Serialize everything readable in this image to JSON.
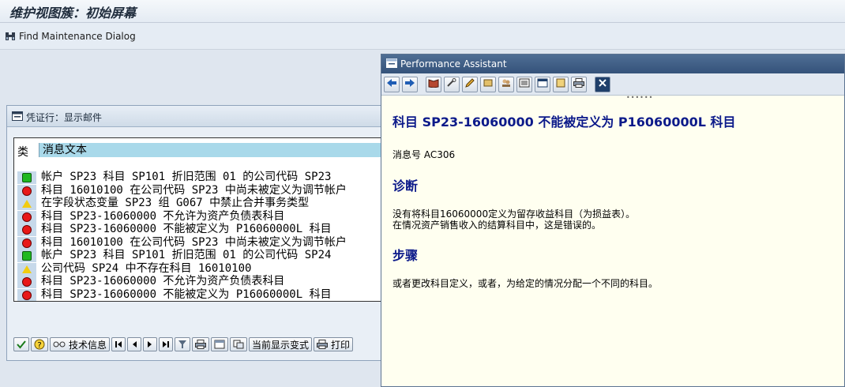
{
  "window": {
    "title": "维护视图簇：初始屏幕"
  },
  "toolbar": {
    "find_label": "Find Maintenance Dialog"
  },
  "log_dialog": {
    "title": "凭证行：显示邮件",
    "columns": {
      "type": "类",
      "text": "消息文本"
    },
    "rows": [
      {
        "status": "green",
        "text": "帐户 SP23 科目 SP101 折旧范围 01 的公司代码 SP23"
      },
      {
        "status": "red",
        "text": "科目 16010100 在公司代码 SP23 中尚未被定义为调节帐户"
      },
      {
        "status": "yellow",
        "text": "在字段状态变量 SP23 组 G067 中禁止合并事务类型"
      },
      {
        "status": "red",
        "text": "科目 SP23-16060000 不允许为资产负债表科目"
      },
      {
        "status": "red",
        "text": "科目 SP23-16060000 不能被定义为 P16060000L 科目"
      },
      {
        "status": "red",
        "text": "科目 16010100 在公司代码 SP23 中尚未被定义为调节帐户"
      },
      {
        "status": "green",
        "text": "帐户 SP23 科目 SP101 折旧范围 01 的公司代码 SP24"
      },
      {
        "status": "yellow",
        "text": "公司代码 SP24 中不存在科目 16010100"
      },
      {
        "status": "red",
        "text": "科目 SP23-16060000 不允许为资产负债表科目"
      },
      {
        "status": "red",
        "text": "科目 SP23-16060000 不能被定义为 P16060000L 科目"
      }
    ],
    "footer": {
      "tech_info_label": "技术信息",
      "current_layout_label": "当前显示变式",
      "print_label": "打印"
    }
  },
  "assistant": {
    "title": "Performance Assistant",
    "heading": "科目 SP23-16060000 不能被定义为 P16060000L 科目",
    "message_no": "消息号 AC306",
    "diagnosis_title": "诊断",
    "diagnosis_line1": "没有将科目16060000定义为留存收益科目（为损益表）。",
    "diagnosis_line2": "在情况资产销售收入的结算科目中，这是错误的。",
    "procedure_title": "步骤",
    "procedure_text": "或者更改科目定义，或者，为给定的情况分配一个不同的科目。"
  },
  "colors": {
    "status_green": "#20b820",
    "status_red": "#e81818",
    "status_yellow": "#f2cc10",
    "assistant_bg": "#fffff0",
    "header_blue": "#a9d9ea"
  }
}
